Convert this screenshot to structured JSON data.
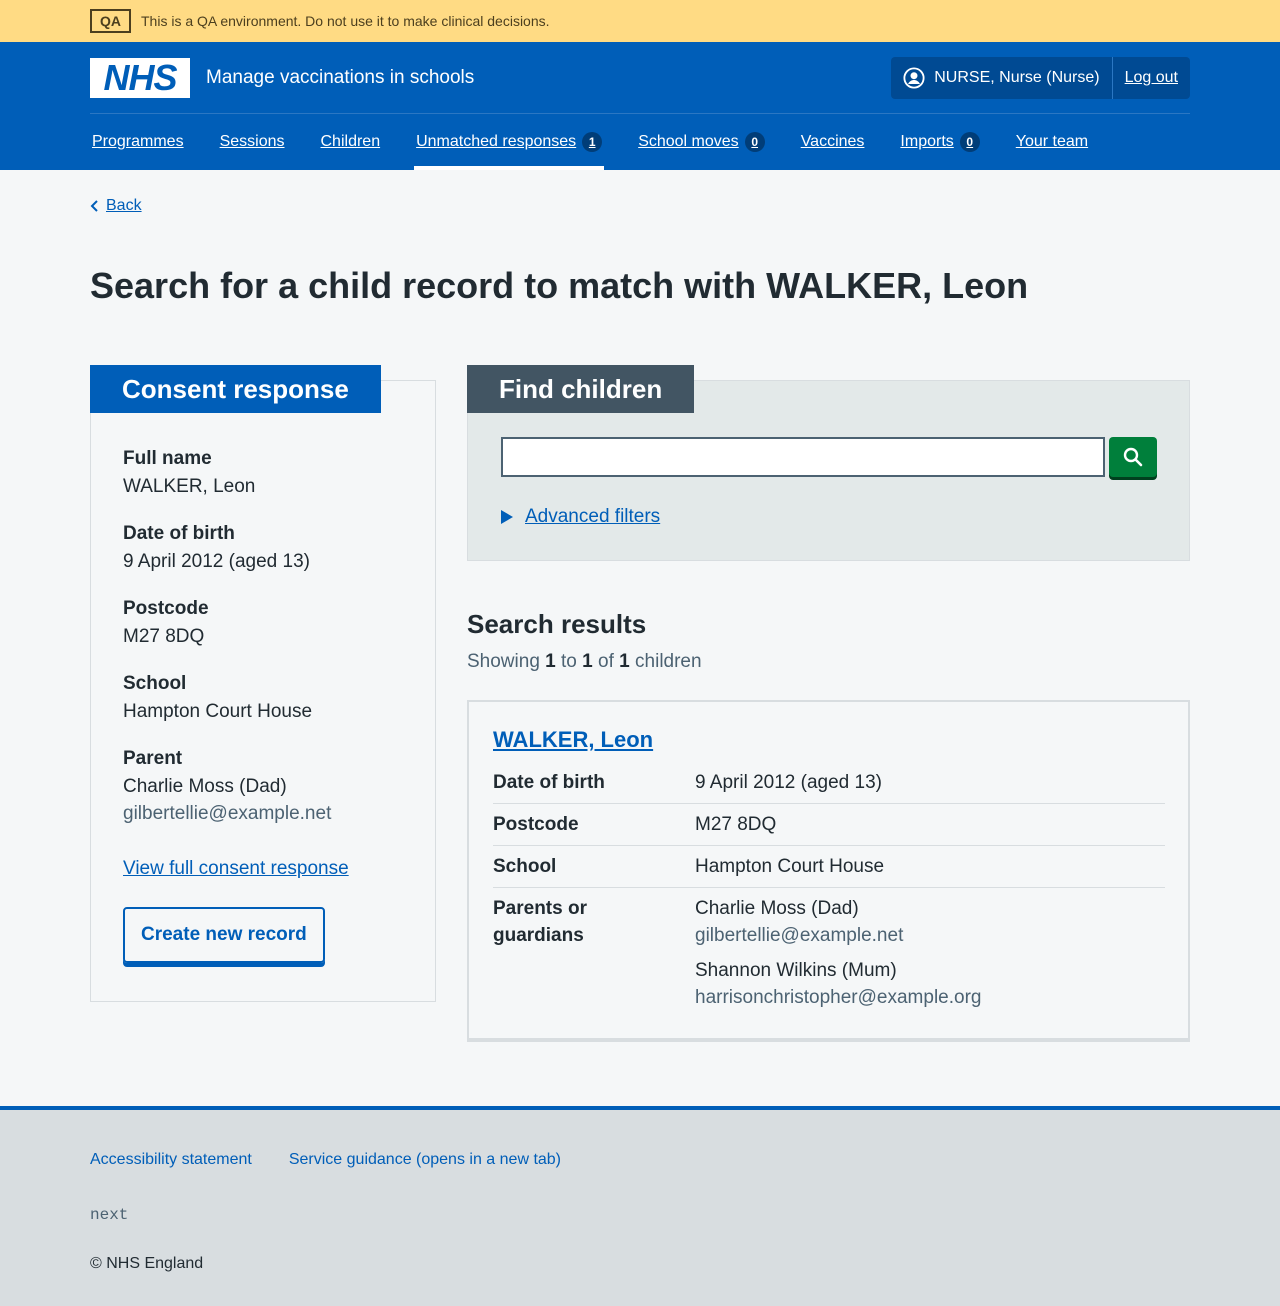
{
  "env_banner": {
    "tag": "QA",
    "message": "This is a QA environment. Do not use it to make clinical decisions."
  },
  "header": {
    "logo": "NHS",
    "service_name": "Manage vaccinations in schools",
    "user": "NURSE, Nurse (Nurse)",
    "logout": "Log out"
  },
  "nav": [
    {
      "label": "Programmes"
    },
    {
      "label": "Sessions"
    },
    {
      "label": "Children"
    },
    {
      "label": "Unmatched responses",
      "count": "1",
      "active": true
    },
    {
      "label": "School moves",
      "count": "0"
    },
    {
      "label": "Vaccines"
    },
    {
      "label": "Imports",
      "count": "0"
    },
    {
      "label": "Your team"
    }
  ],
  "back": "Back",
  "page_title": "Search for a child record to match with WALKER, Leon",
  "consent": {
    "heading": "Consent response",
    "full_name_label": "Full name",
    "full_name": "WALKER, Leon",
    "dob_label": "Date of birth",
    "dob": "9 April 2012 (aged 13)",
    "postcode_label": "Postcode",
    "postcode": "M27 8DQ",
    "school_label": "School",
    "school": "Hampton Court House",
    "parent_label": "Parent",
    "parent_name": "Charlie Moss (Dad)",
    "parent_email": "gilbertellie@example.net",
    "view_link": "View full consent response",
    "create_button": "Create new record"
  },
  "find": {
    "heading": "Find children",
    "search_value": "",
    "advanced_filters": "Advanced filters"
  },
  "results": {
    "heading": "Search results",
    "showing_prefix": "Showing",
    "from": "1",
    "to_word": "to",
    "to": "1",
    "of_word": "of",
    "total": "1",
    "suffix": "children",
    "item": {
      "name": "WALKER, Leon",
      "dob_label": "Date of birth",
      "dob": "9 April 2012 (aged 13)",
      "postcode_label": "Postcode",
      "postcode": "M27 8DQ",
      "school_label": "School",
      "school": "Hampton Court House",
      "parents_label": "Parents or guardians",
      "parent1_name": "Charlie Moss (Dad)",
      "parent1_email": "gilbertellie@example.net",
      "parent2_name": "Shannon Wilkins (Mum)",
      "parent2_email": "harrisonchristopher@example.org"
    }
  },
  "footer": {
    "accessibility": "Accessibility statement",
    "guidance": "Service guidance (opens in a new tab)",
    "version": "next",
    "copyright": "© NHS England"
  },
  "colors": {
    "nhs_blue": "#005eb8",
    "banner": "#ffdb84",
    "search_button": "#007f3b",
    "find_tab": "#425563"
  }
}
